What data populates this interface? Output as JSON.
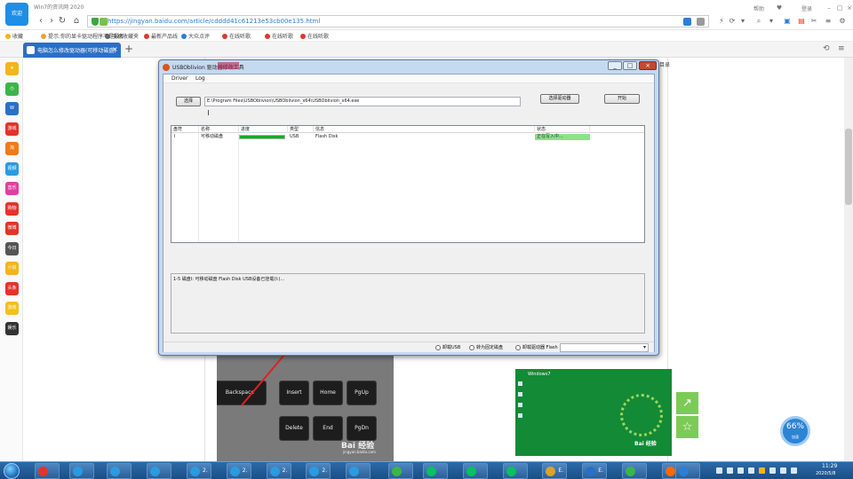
{
  "browser": {
    "logo_label": "欢迎",
    "page_title": "Win7的资讯网 2020",
    "url": "https://jingyan.baidu.com/article/cdddd41c61213e53cb00e135.html",
    "top_right_1": "帮助",
    "top_right_2": "登录",
    "nav": {
      "back": "‹",
      "forward": "›",
      "refresh": "↻",
      "home": "⌂"
    }
  },
  "bookmarks": [
    {
      "label": "收藏",
      "color": "#f2b51c"
    },
    {
      "label": "提示:你的显卡驱动程序不是最新",
      "color": "#e8a13a"
    },
    {
      "label": "手机收藏夹",
      "color": "#666666"
    },
    {
      "label": "最新产品线",
      "color": "#d93a2b"
    },
    {
      "label": "大众点评",
      "color": "#2a7fd4"
    },
    {
      "label": "在线听歌",
      "color": "#d93a2b"
    },
    {
      "label": "在线听歌",
      "color": "#d93a2b"
    },
    {
      "label": "在线听歌",
      "color": "#d93a2b"
    }
  ],
  "tabs": {
    "active_label": "电脑怎么修改驱动器(可移动磁盘)",
    "close_glyph": "×",
    "new_tab": "+",
    "right_1": "⟲",
    "right_2": "≡"
  },
  "sidebar": [
    {
      "label": "★",
      "color": "#f2b51c"
    },
    {
      "label": "◷",
      "color": "#3bb54a"
    },
    {
      "label": "W",
      "color": "#2b6fc5"
    },
    {
      "label": "游戏",
      "color": "#e4332a"
    },
    {
      "label": "淘",
      "color": "#f07a1a"
    },
    {
      "label": "视频",
      "color": "#2a9be0"
    },
    {
      "label": "音乐",
      "color": "#e040a0"
    },
    {
      "label": "购物",
      "color": "#e4332a"
    },
    {
      "label": "微博",
      "color": "#e4332a"
    },
    {
      "label": "今日",
      "color": "#555555"
    },
    {
      "label": "小说",
      "color": "#f2b51c"
    },
    {
      "label": "头条",
      "color": "#e4332a"
    },
    {
      "label": "游戏",
      "color": "#f2c01c"
    },
    {
      "label": "娱乐",
      "color": "#333333"
    }
  ],
  "dialog": {
    "title": "USBOblivion 驱动器修改工具",
    "menu": [
      "Driver",
      "Log"
    ],
    "browse_label": "选择",
    "path_value": "E:\\Program Files\\USBOblivion\\USBOblivion_x64\\USBOblivion_x64.exe",
    "right_button_1": "选择驱动器",
    "right_button_2": "开始",
    "columns": [
      "盘符",
      "名称",
      "进度",
      "类型",
      "信息",
      "状态"
    ],
    "row": {
      "letter": "I",
      "name": "可移动磁盘",
      "progress": 1.0,
      "type": "USB",
      "info": "Flash Disk",
      "status": "正在写入中..."
    },
    "log_text": "1-5 磁盘I: 可移动磁盘 Flash Disk USB设备已挂载(I:)...",
    "radios": [
      "卸载USB",
      "转为固定磁盘",
      "卸载驱动器 Flash"
    ],
    "combo_glyph": "▾",
    "controls": {
      "min": "_",
      "max": "□",
      "close": "×"
    }
  },
  "page": {
    "behind_label": "目录",
    "keyboard_keys": [
      "Backspace",
      "Insert",
      "Home",
      "PgUp",
      "Delete",
      "End",
      "PgDn"
    ],
    "watermark": "Bai 经验",
    "watermark_sub": "jingyan.baidu.com",
    "green_title": "Windows7",
    "green_watermark": "Bai 经验",
    "share_glyph": "↗",
    "fav_glyph": "☆",
    "speed_value": "66",
    "speed_unit": "%",
    "speed_sub": "加速"
  },
  "taskbar": {
    "buttons": [
      {
        "label": "",
        "color": "#e4332a"
      },
      {
        "label": "",
        "color": "#2a9be0"
      },
      {
        "label": "",
        "color": "#2a9be0"
      },
      {
        "label": "",
        "color": "#2a9be0"
      },
      {
        "label": "2.",
        "color": "#2a9be0"
      },
      {
        "label": "2.",
        "color": "#2a9be0"
      },
      {
        "label": "2.",
        "color": "#2a9be0"
      },
      {
        "label": "2.",
        "color": "#2a9be0"
      },
      {
        "label": "",
        "color": "#2a9be0"
      },
      {
        "label": "",
        "color": "#3bb54a"
      },
      {
        "label": "",
        "color": "#07c160"
      },
      {
        "label": "",
        "color": "#07c160"
      },
      {
        "label": "",
        "color": "#07c160"
      },
      {
        "label": "E.",
        "color": "#d9a32b"
      },
      {
        "label": "E.",
        "color": "#2b6fc5"
      },
      {
        "label": "",
        "color": "#3bb54a"
      },
      {
        "label": "D.",
        "color": "#ff6900"
      },
      {
        "label": "",
        "color": "#2a7fd4"
      }
    ],
    "time": "11:29",
    "date": "2020/5/8"
  }
}
